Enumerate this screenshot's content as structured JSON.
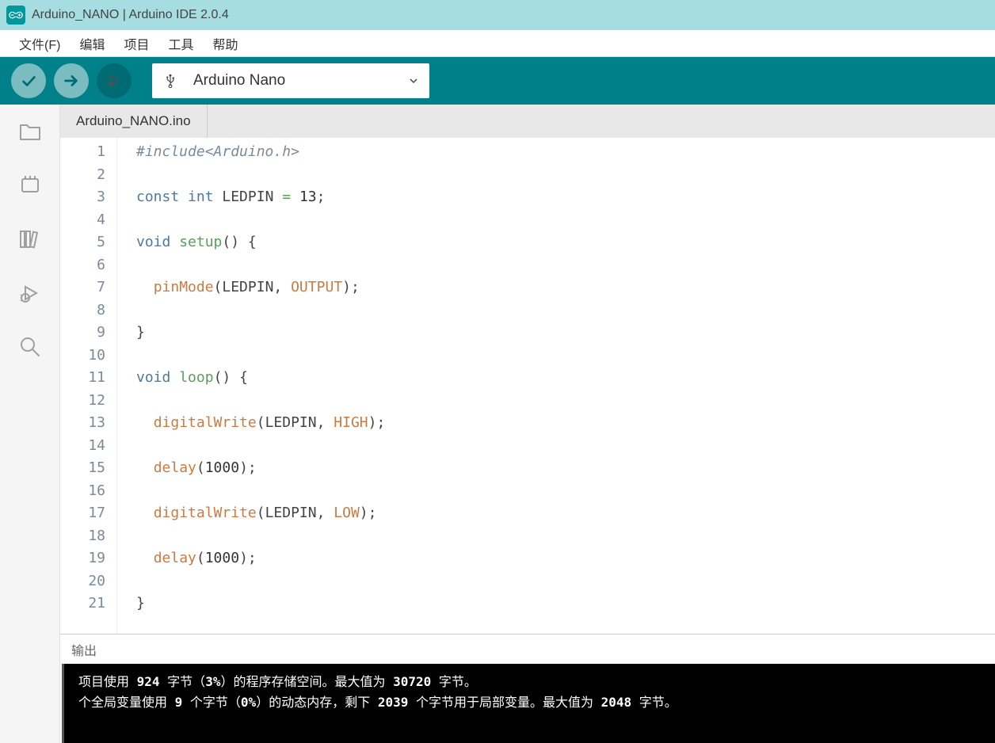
{
  "window": {
    "title": "Arduino_NANO | Arduino IDE 2.0.4"
  },
  "menubar": {
    "items": [
      "文件(F)",
      "编辑",
      "项目",
      "工具",
      "帮助"
    ]
  },
  "toolbar": {
    "board_name": "Arduino Nano"
  },
  "tabs": {
    "active": "Arduino_NANO.ino"
  },
  "code": {
    "lines": [
      {
        "n": 1,
        "t": [
          {
            "c": "k-inc",
            "s": "#include<Arduino.h>"
          }
        ]
      },
      {
        "n": 2,
        "t": []
      },
      {
        "n": 3,
        "t": [
          {
            "c": "k-blue",
            "s": "const int"
          },
          {
            "c": "code-text",
            "s": " LEDPIN "
          },
          {
            "c": "k-green",
            "s": "="
          },
          {
            "c": "code-text",
            "s": " "
          },
          {
            "c": "k-num",
            "s": "13"
          },
          {
            "c": "code-text",
            "s": ";"
          }
        ]
      },
      {
        "n": 4,
        "t": []
      },
      {
        "n": 5,
        "t": [
          {
            "c": "k-blue",
            "s": "void"
          },
          {
            "c": "code-text",
            "s": " "
          },
          {
            "c": "k-green",
            "s": "setup"
          },
          {
            "c": "code-text",
            "s": "() {"
          }
        ]
      },
      {
        "n": 6,
        "t": []
      },
      {
        "n": 7,
        "t": [
          {
            "c": "code-text",
            "s": "  "
          },
          {
            "c": "k-func",
            "s": "pinMode"
          },
          {
            "c": "code-text",
            "s": "(LEDPIN, "
          },
          {
            "c": "k-const",
            "s": "OUTPUT"
          },
          {
            "c": "code-text",
            "s": ");"
          }
        ]
      },
      {
        "n": 8,
        "t": []
      },
      {
        "n": 9,
        "t": [
          {
            "c": "code-text",
            "s": "}"
          }
        ]
      },
      {
        "n": 10,
        "t": []
      },
      {
        "n": 11,
        "t": [
          {
            "c": "k-blue",
            "s": "void"
          },
          {
            "c": "code-text",
            "s": " "
          },
          {
            "c": "k-green",
            "s": "loop"
          },
          {
            "c": "code-text",
            "s": "() {"
          }
        ]
      },
      {
        "n": 12,
        "t": []
      },
      {
        "n": 13,
        "t": [
          {
            "c": "code-text",
            "s": "  "
          },
          {
            "c": "k-func",
            "s": "digitalWrite"
          },
          {
            "c": "code-text",
            "s": "(LEDPIN, "
          },
          {
            "c": "k-const",
            "s": "HIGH"
          },
          {
            "c": "code-text",
            "s": ");"
          }
        ]
      },
      {
        "n": 14,
        "t": []
      },
      {
        "n": 15,
        "t": [
          {
            "c": "code-text",
            "s": "  "
          },
          {
            "c": "k-func",
            "s": "delay"
          },
          {
            "c": "code-text",
            "s": "("
          },
          {
            "c": "k-num",
            "s": "1000"
          },
          {
            "c": "code-text",
            "s": ");"
          }
        ]
      },
      {
        "n": 16,
        "t": []
      },
      {
        "n": 17,
        "t": [
          {
            "c": "code-text",
            "s": "  "
          },
          {
            "c": "k-func",
            "s": "digitalWrite"
          },
          {
            "c": "code-text",
            "s": "(LEDPIN, "
          },
          {
            "c": "k-const",
            "s": "LOW"
          },
          {
            "c": "code-text",
            "s": ");"
          }
        ]
      },
      {
        "n": 18,
        "t": []
      },
      {
        "n": 19,
        "t": [
          {
            "c": "code-text",
            "s": "  "
          },
          {
            "c": "k-func",
            "s": "delay"
          },
          {
            "c": "code-text",
            "s": "("
          },
          {
            "c": "k-num",
            "s": "1000"
          },
          {
            "c": "code-text",
            "s": ");"
          }
        ]
      },
      {
        "n": 20,
        "t": []
      },
      {
        "n": 21,
        "t": [
          {
            "c": "code-text",
            "s": "}"
          }
        ]
      }
    ]
  },
  "output": {
    "header": "输出",
    "line1_pre": "项目使用 ",
    "line1_bytes": "924",
    "line1_mid1": " 字节（",
    "line1_pct": "3%",
    "line1_mid2": "）的程序存储空间。最大值为 ",
    "line1_max": "30720",
    "line1_post": " 字节。",
    "line2_pre": "个全局变量使用 ",
    "line2_bytes": "9",
    "line2_mid1": " 个字节（",
    "line2_pct": "0%",
    "line2_mid2": "）的动态内存，剩下 ",
    "line2_rem": "2039",
    "line2_mid3": " 个字节用于局部变量。最大值为 ",
    "line2_max": "2048",
    "line2_post": " 字节。"
  }
}
